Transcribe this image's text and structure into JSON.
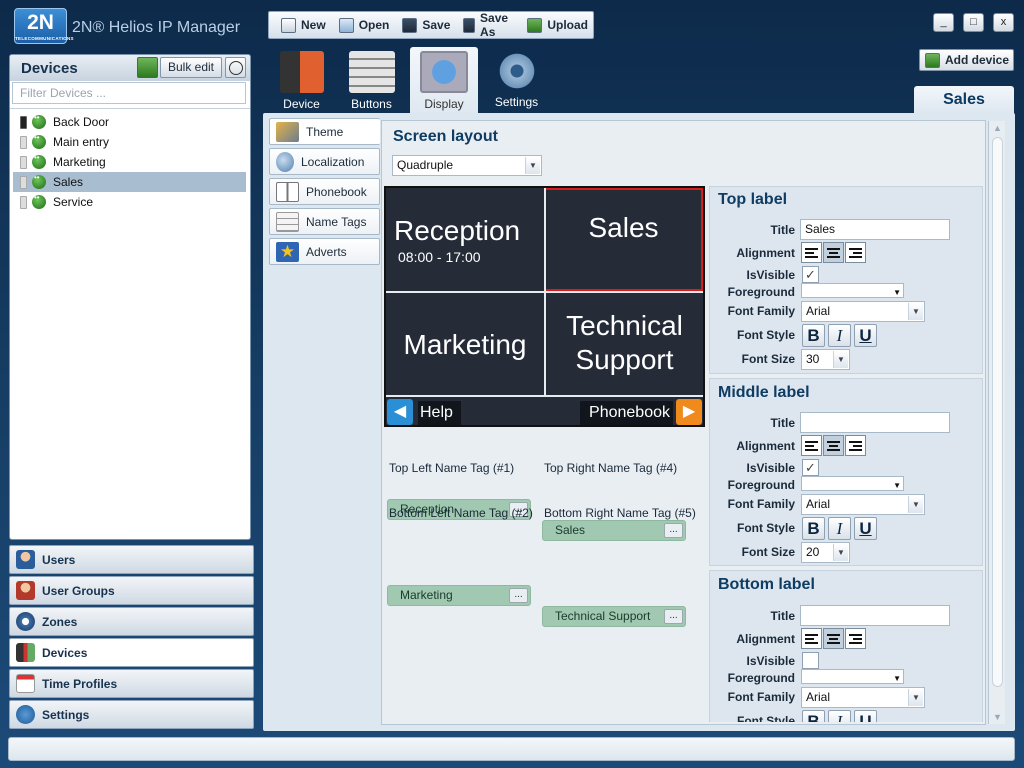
{
  "app": {
    "logo": "2N",
    "logo_sub": "TELECOMMUNICATIONS",
    "title": "2N® Helios IP Manager"
  },
  "toolbar": {
    "new": "New",
    "open": "Open",
    "save": "Save",
    "save_as": "Save As",
    "upload": "Upload"
  },
  "window": {
    "minimize": "_",
    "maximize": "□",
    "close": "x"
  },
  "add_device": "Add device",
  "devices_panel": {
    "title": "Devices",
    "bulk_edit": "Bulk edit",
    "filter_placeholder": "Filter Devices ...",
    "items": [
      {
        "label": "Back Door",
        "selected": false
      },
      {
        "label": "Main entry",
        "selected": false
      },
      {
        "label": "Marketing",
        "selected": false
      },
      {
        "label": "Sales",
        "selected": true
      },
      {
        "label": "Service",
        "selected": false
      }
    ]
  },
  "nav": [
    {
      "label": "Users",
      "icon": "user-icon"
    },
    {
      "label": "User Groups",
      "icon": "user-group-icon"
    },
    {
      "label": "Zones",
      "icon": "zone-icon"
    },
    {
      "label": "Devices",
      "icon": "device-icon",
      "active": true
    },
    {
      "label": "Time Profiles",
      "icon": "calendar-icon"
    },
    {
      "label": "Settings",
      "icon": "info-icon"
    }
  ],
  "main_tabs": [
    {
      "label": "Device"
    },
    {
      "label": "Buttons"
    },
    {
      "label": "Display",
      "active": true
    },
    {
      "label": "Settings"
    }
  ],
  "device_tab": "Sales",
  "sub_tabs": [
    {
      "label": "Theme",
      "active": true
    },
    {
      "label": "Localization"
    },
    {
      "label": "Phonebook"
    },
    {
      "label": "Name Tags"
    },
    {
      "label": "Adverts"
    }
  ],
  "screen_layout": {
    "title": "Screen layout",
    "selected": "Quadruple",
    "cells": {
      "top_left": "Reception",
      "top_left_sub": "08:00 - 17:00",
      "top_right": "Sales",
      "bottom_left": "Marketing",
      "bottom_right_line1": "Technical",
      "bottom_right_line2": "Support"
    },
    "help": "Help",
    "phonebook": "Phonebook"
  },
  "name_tags": [
    {
      "label": "Top Left Name Tag (#1)",
      "value": "Reception"
    },
    {
      "label": "Top Right Name Tag (#4)",
      "value": "Sales"
    },
    {
      "label": "Bottom Left Name Tag (#2)",
      "value": "Marketing"
    },
    {
      "label": "Bottom Right Name Tag (#5)",
      "value": "Technical Support"
    }
  ],
  "dots": "...",
  "labels": {
    "title": "Title",
    "alignment": "Alignment",
    "is_visible": "IsVisible",
    "foreground": "Foreground",
    "font_family": "Font Family",
    "font_style": "Font Style",
    "font_size": "Font Size"
  },
  "top_label": {
    "heading": "Top label",
    "title": "Sales",
    "visible": true,
    "font_family": "Arial",
    "font_size": "30"
  },
  "middle_label": {
    "heading": "Middle label",
    "title": "",
    "visible": true,
    "font_family": "Arial",
    "font_size": "20"
  },
  "bottom_label": {
    "heading": "Bottom label",
    "title": "",
    "visible": false,
    "font_family": "Arial"
  },
  "style_buttons": {
    "bold": "B",
    "italic": "I",
    "underline": "U"
  },
  "colors": {
    "accent": "#0e3c63",
    "selection": "#a9bdd0",
    "tag_green": "#a1c9b2",
    "screen_bg": "#252c38",
    "highlight_red": "#d81b1b",
    "help_blue": "#2a8fd4",
    "phonebook_orange": "#f08a1c"
  }
}
